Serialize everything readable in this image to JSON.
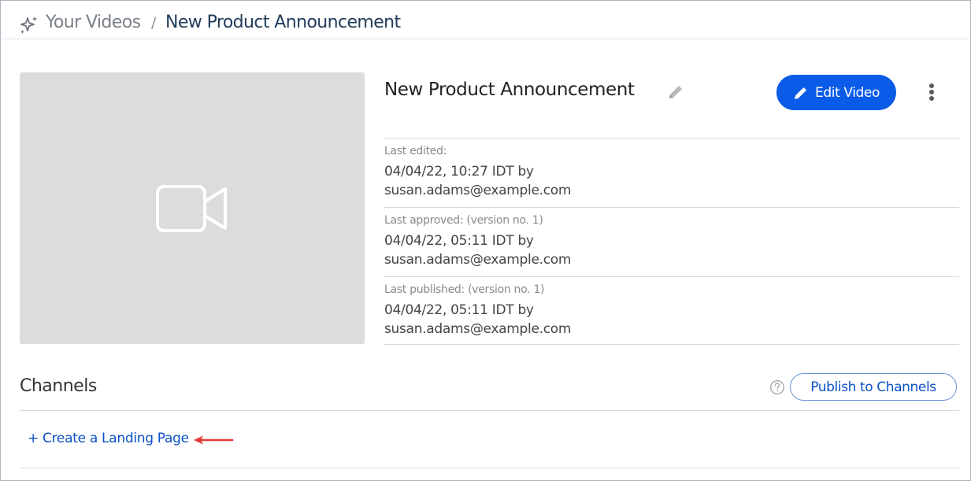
{
  "breadcrumb": {
    "icon": "sparkle-icon",
    "root_label": "Your Videos",
    "separator": "/",
    "current_label": "New Product Announcement"
  },
  "thumbnail": {
    "icon": "video-camera-icon"
  },
  "video": {
    "title": "New Product Announcement",
    "title_edit_icon": "pencil-icon",
    "edit_button_label": "Edit Video",
    "edit_button_icon": "pencil-icon",
    "more_icon": "vertical-dots-icon"
  },
  "meta": [
    {
      "label": "Last edited:",
      "line1": "04/04/22, 10:27 IDT by",
      "line2": "susan.adams@example.com"
    },
    {
      "label": "Last approved: (version no. 1)",
      "line1": "04/04/22, 05:11 IDT by",
      "line2": "susan.adams@example.com"
    },
    {
      "label": "Last published: (version no. 1)",
      "line1": "04/04/22, 05:11 IDT by",
      "line2": "susan.adams@example.com"
    }
  ],
  "channels": {
    "title": "Channels",
    "help_icon": "question-circle-icon",
    "publish_button_label": "Publish to Channels",
    "create_link_label": "+ Create a Landing Page",
    "annotation_icon": "red-arrow-icon"
  },
  "colors": {
    "accent": "#0a5be8",
    "link": "#0a4fc7",
    "thumbnail_bg": "#dcdcdc",
    "annotation_arrow": "#e53935"
  }
}
